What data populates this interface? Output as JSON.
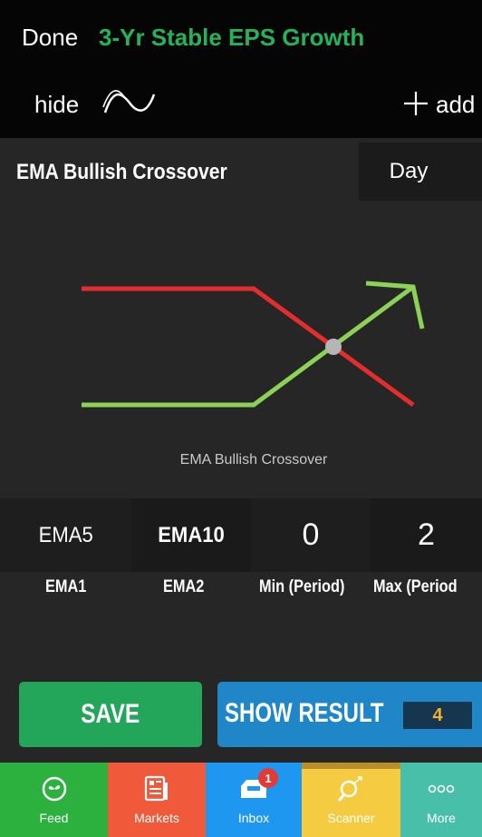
{
  "topbar": {
    "done_label": "Done",
    "title": "3-Yr Stable EPS Growth",
    "hide_label": "hide",
    "add_label": "add",
    "title_color": "#23b45a"
  },
  "criteria": {
    "name": "EMA Bullish Crossover",
    "timeframe": "Day"
  },
  "diagram": {
    "caption": "EMA Bullish Crossover",
    "bearish_line_color": "#e42d2d",
    "bullish_line_color": "#8cd256",
    "cross_point_color": "#b5b5b5"
  },
  "params": [
    {
      "value": "EMA5",
      "label": "EMA1"
    },
    {
      "value": "EMA10",
      "label": "EMA2"
    },
    {
      "value": "0",
      "label": "Min (Period)"
    },
    {
      "value": "2",
      "label": "Max (Period"
    }
  ],
  "actions": {
    "save_label": "SAVE",
    "show_result_label": "SHOW RESULT",
    "result_count": "4"
  },
  "tabbar": {
    "tabs": [
      {
        "label": "Feed",
        "icon": "feed-icon",
        "color": "#2cb13f"
      },
      {
        "label": "Markets",
        "icon": "newspaper-icon",
        "color": "#f05a3b"
      },
      {
        "label": "Inbox",
        "icon": "inbox-icon",
        "color": "#1e97f0",
        "badge": "1"
      },
      {
        "label": "Scanner",
        "icon": "scanner-icon",
        "color": "#f5cc41",
        "selected": true
      },
      {
        "label": "More",
        "icon": "more-icon",
        "color": "#48c0a9"
      }
    ]
  }
}
